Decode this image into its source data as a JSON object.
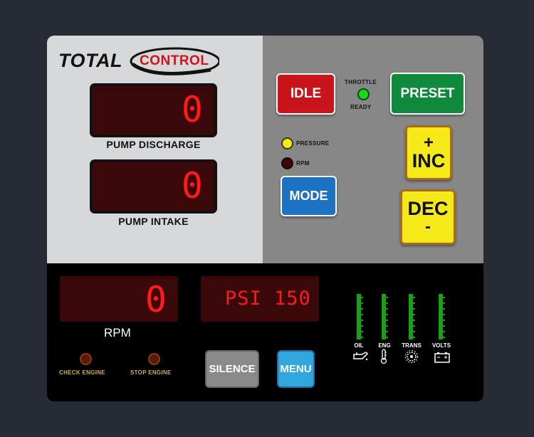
{
  "logo": {
    "total": "TOTAL",
    "control": "CONTROL"
  },
  "displays": {
    "pump_discharge": {
      "value": "0",
      "label": "PUMP DISCHARGE"
    },
    "pump_intake": {
      "value": "0",
      "label": "PUMP INTAKE"
    },
    "rpm": {
      "value": "0",
      "label": "RPM"
    },
    "psi": {
      "value": "PSI 150"
    }
  },
  "buttons": {
    "idle": "IDLE",
    "preset": "PRESET",
    "mode": "MODE",
    "inc_symbol": "+",
    "inc_label": "INC",
    "dec_label": "DEC",
    "dec_symbol": "-",
    "silence": "SILENCE",
    "menu": "MENU"
  },
  "indicators": {
    "throttle_top": "THROTTLE",
    "throttle_bottom": "READY",
    "throttle_color": "#1ed61e",
    "pressure": "PRESSURE",
    "pressure_color": "#f3ec1a",
    "rpm": "RPM",
    "check_engine": "CHECK ENGINE",
    "stop_engine": "STOP ENGINE"
  },
  "gauges": [
    {
      "label": "OIL",
      "icon": "oil-can-icon"
    },
    {
      "label": "ENG",
      "icon": "thermometer-icon"
    },
    {
      "label": "TRANS",
      "icon": "gear-icon"
    },
    {
      "label": "VOLTS",
      "icon": "battery-icon"
    }
  ],
  "colors": {
    "stop_red": "#c8141a",
    "preset_green": "#0f8a3d",
    "mode_blue": "#1e72c4",
    "inc_dec_yellow": "#f6e91a",
    "lcd_red": "#ff1a1a",
    "gauge_green": "#19a019"
  }
}
